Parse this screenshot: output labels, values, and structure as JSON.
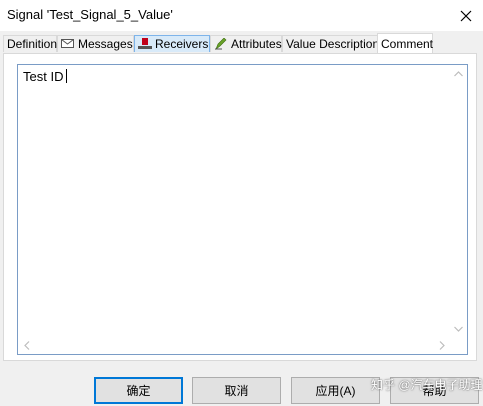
{
  "dialog": {
    "title": "Signal 'Test_Signal_5_Value'",
    "close_glyph": "✕"
  },
  "tabs": [
    {
      "label": "Definition",
      "icon": null
    },
    {
      "label": "Messages",
      "icon": "envelope-icon"
    },
    {
      "label": "Receivers",
      "icon": "receiver-node-icon"
    },
    {
      "label": "Attributes",
      "icon": "attribute-pen-icon"
    },
    {
      "label": "Value Descriptions",
      "icon": null
    },
    {
      "label": "Comment",
      "icon": null
    }
  ],
  "active_tab": "Comment",
  "comment": {
    "text": "Test ID"
  },
  "buttons": {
    "ok": "确定",
    "cancel": "取消",
    "apply": "应用(A)",
    "help": "帮助"
  },
  "watermark": "知乎 @汽车电子助理",
  "colors": {
    "accent": "#0078d7",
    "tab_hover": "#d8eaf9",
    "receiver_icon": "#c0001a"
  }
}
